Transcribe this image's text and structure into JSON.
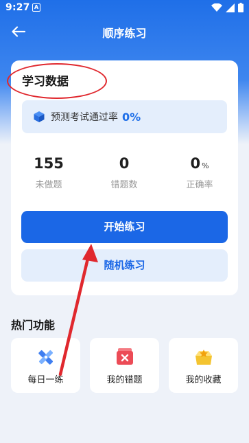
{
  "status_bar": {
    "time": "9:27",
    "notif_glyph": "A"
  },
  "header": {
    "title": "顺序练习"
  },
  "study_card": {
    "title": "学习数据",
    "pass_rate_label": "预测考试通过率",
    "pass_rate_value": "0%",
    "stats": [
      {
        "value": "155",
        "unit": "",
        "label": "未做题"
      },
      {
        "value": "0",
        "unit": "",
        "label": "错题数"
      },
      {
        "value": "0",
        "unit": "%",
        "label": "正确率"
      }
    ],
    "start_button": "开始练习",
    "random_button": "随机练习"
  },
  "hot_features": {
    "title": "热门功能",
    "items": [
      {
        "label": "每日一练",
        "icon": "ruler-pencil-icon"
      },
      {
        "label": "我的错题",
        "icon": "wrong-questions-icon"
      },
      {
        "label": "我的收藏",
        "icon": "favorites-box-icon"
      }
    ]
  },
  "colors": {
    "primary": "#1b67e6",
    "light_blue": "#e4eefc",
    "annotation_red": "#e0282e"
  }
}
